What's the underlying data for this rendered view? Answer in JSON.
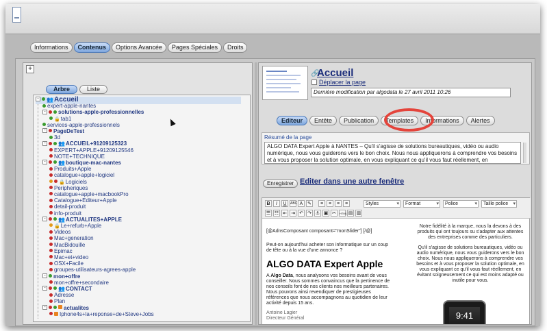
{
  "main_tabs": [
    {
      "label": "Informations",
      "active": false
    },
    {
      "label": "Contenus",
      "active": true
    },
    {
      "label": "Options Avancée",
      "active": false
    },
    {
      "label": "Pages Spéciales",
      "active": false
    },
    {
      "label": "Droits",
      "active": false
    }
  ],
  "tree": {
    "plus_label": "+",
    "tabs": [
      {
        "label": "Arbre",
        "active": true
      },
      {
        "label": "Liste",
        "active": false
      }
    ],
    "nodes": [
      {
        "label": "Accueil",
        "level": 0,
        "exp": "-",
        "dots": [
          "g"
        ],
        "icon": "people",
        "bold": true,
        "big": true,
        "selected": true
      },
      {
        "label": "expert-apple-nantes",
        "level": 1,
        "dots": [
          "g"
        ]
      },
      {
        "label": "solutions-apple-professionnelles",
        "level": 1,
        "exp": "-",
        "dots": [
          "r",
          "g"
        ],
        "bold": true
      },
      {
        "label": "tab1",
        "level": 2,
        "dots": [
          "g"
        ],
        "icon": "lock"
      },
      {
        "label": "services-apple-professionnels",
        "level": 1,
        "dots": [
          "g"
        ]
      },
      {
        "label": "PageDeTest",
        "level": 1,
        "exp": "-",
        "dots": [
          "r"
        ],
        "bold": true
      },
      {
        "label": "3d",
        "level": 2,
        "dots": [
          "g"
        ]
      },
      {
        "label": "ACCUEIL+91209125323",
        "level": 1,
        "exp": "-",
        "dots": [
          "r",
          "g"
        ],
        "icon": "people",
        "bold": true
      },
      {
        "label": "EXPERT+APPLE+91209125546",
        "level": 2,
        "dots": [
          "r"
        ]
      },
      {
        "label": "NOTE+TECHNIQUE",
        "level": 2,
        "dots": [
          "r"
        ]
      },
      {
        "label": "boutique-mac-nantes",
        "level": 1,
        "exp": "-",
        "dots": [
          "r",
          "g"
        ],
        "icon": "people",
        "bold": true
      },
      {
        "label": "Produits+Apple",
        "level": 2,
        "dots": [
          "r"
        ]
      },
      {
        "label": "catalogue+apple+logiciel",
        "level": 2,
        "dots": [
          "r"
        ]
      },
      {
        "label": "Logiciels",
        "level": 2,
        "dots": [
          "o",
          "r"
        ],
        "icon": "lock"
      },
      {
        "label": "Peripheriques",
        "level": 2,
        "dots": [
          "r"
        ]
      },
      {
        "label": "catalogue+apple+macbookPro",
        "level": 2,
        "dots": [
          "r"
        ]
      },
      {
        "label": "Catalogue+Editeur+Apple",
        "level": 2,
        "dots": [
          "r"
        ]
      },
      {
        "label": "detail-produit",
        "level": 2,
        "dots": [
          "r"
        ]
      },
      {
        "label": "info-produit",
        "level": 2,
        "dots": [
          "r"
        ]
      },
      {
        "label": "ACTUALITES+APPLE",
        "level": 1,
        "exp": "-",
        "dots": [
          "r",
          "g"
        ],
        "icon": "people",
        "bold": true
      },
      {
        "label": "Le+refurb+Apple",
        "level": 2,
        "dots": [
          "o"
        ],
        "icon": "lock"
      },
      {
        "label": "Videos",
        "level": 2,
        "dots": [
          "r"
        ]
      },
      {
        "label": "Mac+generation",
        "level": 2,
        "dots": [
          "r"
        ]
      },
      {
        "label": "MacBidouille",
        "level": 2,
        "dots": [
          "r"
        ]
      },
      {
        "label": "Epimac",
        "level": 2,
        "dots": [
          "r"
        ]
      },
      {
        "label": "Mac+et+video",
        "level": 2,
        "dots": [
          "r"
        ]
      },
      {
        "label": "OSX+Facile",
        "level": 2,
        "dots": [
          "r"
        ]
      },
      {
        "label": "groupes-utilisateurs-agrees-apple",
        "level": 2,
        "dots": [
          "r"
        ]
      },
      {
        "label": "mon+offre",
        "level": 1,
        "exp": "-",
        "dots": [
          "g"
        ],
        "bold": true
      },
      {
        "label": "mon+offre+secondaire",
        "level": 2,
        "dots": [
          "r"
        ]
      },
      {
        "label": "CONTACT",
        "level": 1,
        "exp": "-",
        "dots": [
          "r",
          "g"
        ],
        "icon": "people",
        "bold": true
      },
      {
        "label": "Adresse",
        "level": 2,
        "dots": [
          "r"
        ]
      },
      {
        "label": "Plan",
        "level": 2,
        "dots": [
          "r"
        ]
      },
      {
        "label": "actualites",
        "level": 1,
        "exp": "-",
        "dots": [
          "r",
          "g"
        ],
        "icon": "rss",
        "bold": true
      },
      {
        "label": "Iphone4s+la+reponse+de+Steve+Jobs",
        "level": 2,
        "dots": [
          "r"
        ],
        "icon": "rss"
      }
    ]
  },
  "page": {
    "title": "Accueil",
    "move_link": "Déplacer la page",
    "last_modified": "Dernière modification par algodata le 27 avril 2011 10:26"
  },
  "sub_tabs": [
    {
      "label": "Editeur",
      "active": true
    },
    {
      "label": "Entête",
      "active": false
    },
    {
      "label": "Publication",
      "active": false
    },
    {
      "label": "Templates",
      "active": false
    },
    {
      "label": "Informations",
      "active": false
    },
    {
      "label": "Alertes",
      "active": false
    }
  ],
  "summary": {
    "label": "Résumé de la page",
    "text": "ALGO DATA Expert Apple à NANTES – Qu'il s'agisse de solutions bureautiques, vidéo ou audio numérique, nous vous guiderons vers le bon choix. Nous nous appliquerons à comprendre vos besoins et à vous proposer la solution optimale, en vous expliquant ce qu'il vous faut réellement, en"
  },
  "save_label": "Enregistrer",
  "edit_window_label": "Editer dans une autre fenêtre",
  "toolbar": {
    "row1": [
      "B",
      "I",
      "U",
      "ABC",
      "A",
      "✎",
      "≡",
      "≡",
      "≡",
      "≡"
    ],
    "selects": [
      "Styles",
      "Format",
      "Police",
      "Taille police"
    ],
    "row2": [
      "☰",
      "☷",
      "⇤",
      "⇥",
      "↶",
      "↷",
      "⚓",
      "▣",
      "✂",
      "HTML",
      "▤",
      "▥"
    ]
  },
  "doc": {
    "code": "[@AdnsComposant composant=\"monSlider\"] [/@]",
    "intro": "Peut-on aujourd'hui acheter son informatique sur un coup de tête ou à la vue d'une annonce ?",
    "heading": "ALGO DATA Expert Apple",
    "para_bold": "Algo Data",
    "para_prefix": "A ",
    "para_rest": ", nous analysons vos besoins avant de vous conseiller. Nous sommes convaincus que la pertinence de nos conseils font de nos clients nos meilleurs partenaires. Nous pouvons ainsi revendiquer de prestigieuses références que nous accompagnons au quotidien de leur activité depuis 15 ans.",
    "sign_name": "Antoine Lagier",
    "sign_role": "Directeur Général",
    "right_p1": "Notre fidélité à la marque, nous la devons à des produits qui ont toujours su s'adapter aux attentes des entreprises comme des particuliers.",
    "right_p2": "Qu'il s'agisse de solutions bureautiques, vidéo ou audio numérique, nous vous guiderons vers le bon choix. Nous nous appliquerons à comprendre vos besoins et à vous proposer la solution optimale, en vous expliquant ce qu'il vous faut réellement, en évitant soigneusement ce qui est moins adapté ou inutile pour vous.",
    "phone_time": "9:41"
  },
  "colors": {
    "accent_blue": "#1a2c7a",
    "highlight_ring": "#e4443b",
    "active_tab": "#7fa7dd"
  }
}
